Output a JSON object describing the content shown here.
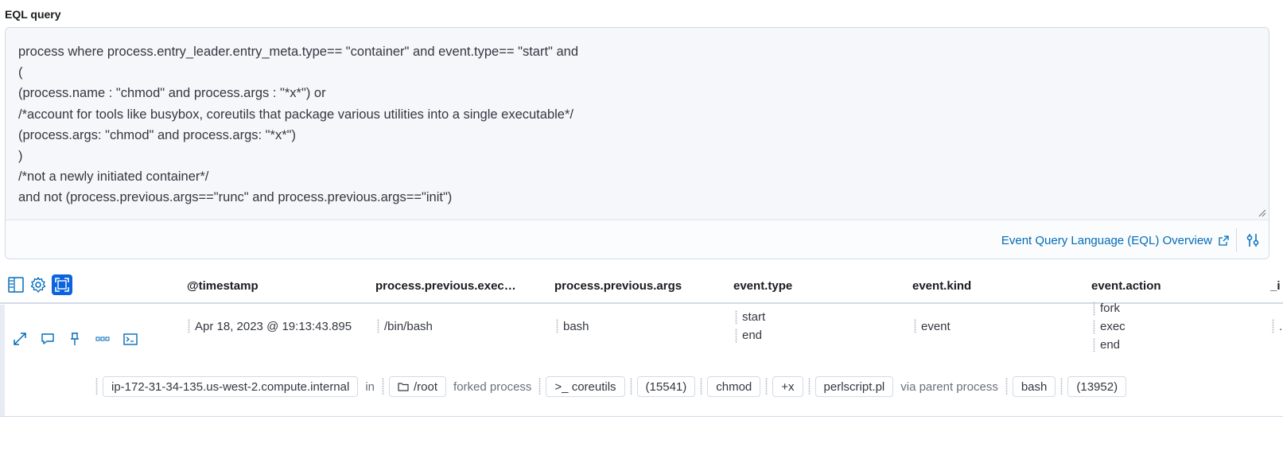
{
  "eql_label": "EQL query",
  "query_lines": [
    "process where process.entry_leader.entry_meta.type== \"container\" and event.type== \"start\" and",
    "(",
    "(process.name : \"chmod\" and process.args : \"*x*\") or",
    "/*account for tools like busybox, coreutils that package various utilities into a single executable*/",
    "(process.args: \"chmod\" and process.args: \"*x*\")",
    ")",
    "/*not a newly initiated container*/",
    "and not (process.previous.args==\"runc\" and process.previous.args==\"init\")"
  ],
  "footer": {
    "eql_overview_link": "Event Query Language (EQL) Overview"
  },
  "columns": [
    "@timestamp",
    "process.previous.exec…",
    "process.previous.args",
    "event.type",
    "event.kind",
    "event.action",
    "_i"
  ],
  "row": {
    "timestamp": "Apr 18, 2023 @ 19:13:43.895",
    "previous_exec": "/bin/bash",
    "previous_args": "bash",
    "event_type": [
      "start",
      "end"
    ],
    "event_kind": "event",
    "event_action": [
      "fork",
      "exec",
      "end"
    ],
    "trailing": "."
  },
  "renderer": {
    "host": "ip-172-31-34-135.us-west-2.compute.internal",
    "in": "in",
    "dir": "/root",
    "forked": "forked process",
    "process": ">_ coreutils",
    "pid": "(15541)",
    "arg1": "chmod",
    "arg2": "+x",
    "arg3": "perlscript.pl",
    "via": "via parent process",
    "parent": "bash",
    "parent_pid": "(13952)"
  },
  "colors": {
    "link": "#006bb8",
    "active_tool": "#0b64dd",
    "border": "#d3dae6"
  }
}
